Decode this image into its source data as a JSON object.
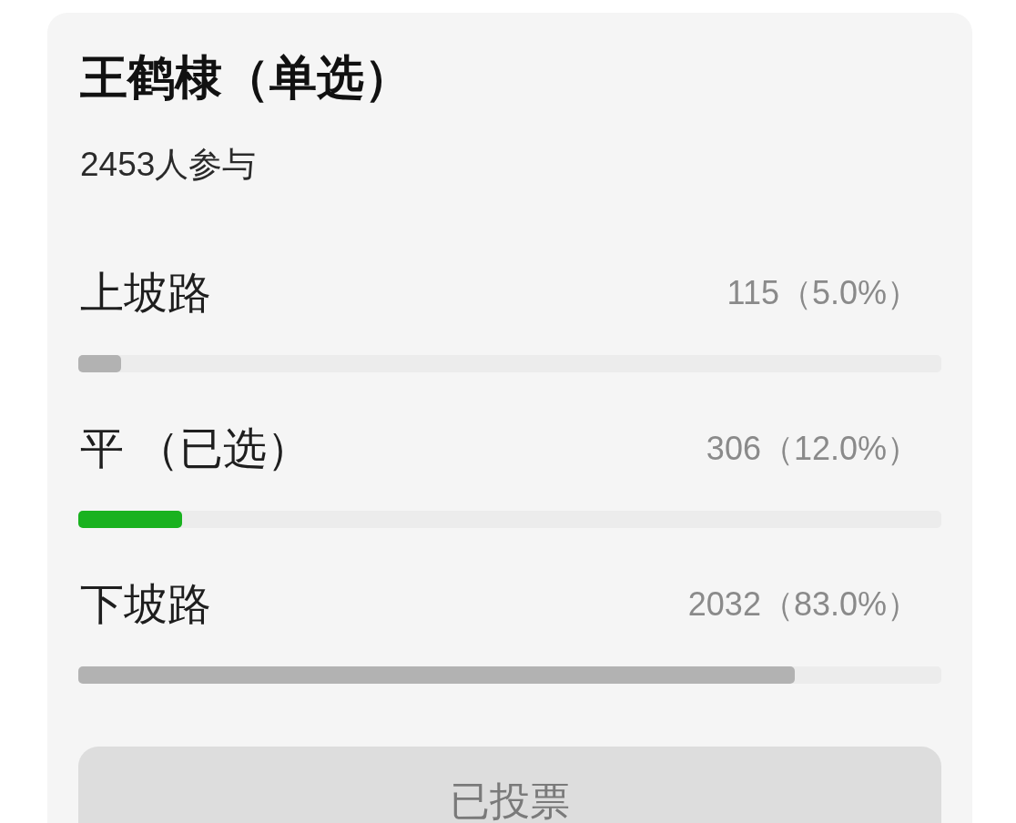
{
  "poll": {
    "title": "王鹤棣（单选）",
    "participants": "2453人参与"
  },
  "options": [
    {
      "label": "上坡路",
      "count": "115（5.0%）",
      "level": 0.05,
      "selected": false
    },
    {
      "label": "平 （已选）",
      "count": "306（12.0%）",
      "level": 0.12,
      "selected": true
    },
    {
      "label": "下坡路",
      "count": "2032（83.0%）",
      "level": 0.83,
      "selected": false
    }
  ],
  "button": {
    "label": "已投票",
    "disabled": true
  }
}
